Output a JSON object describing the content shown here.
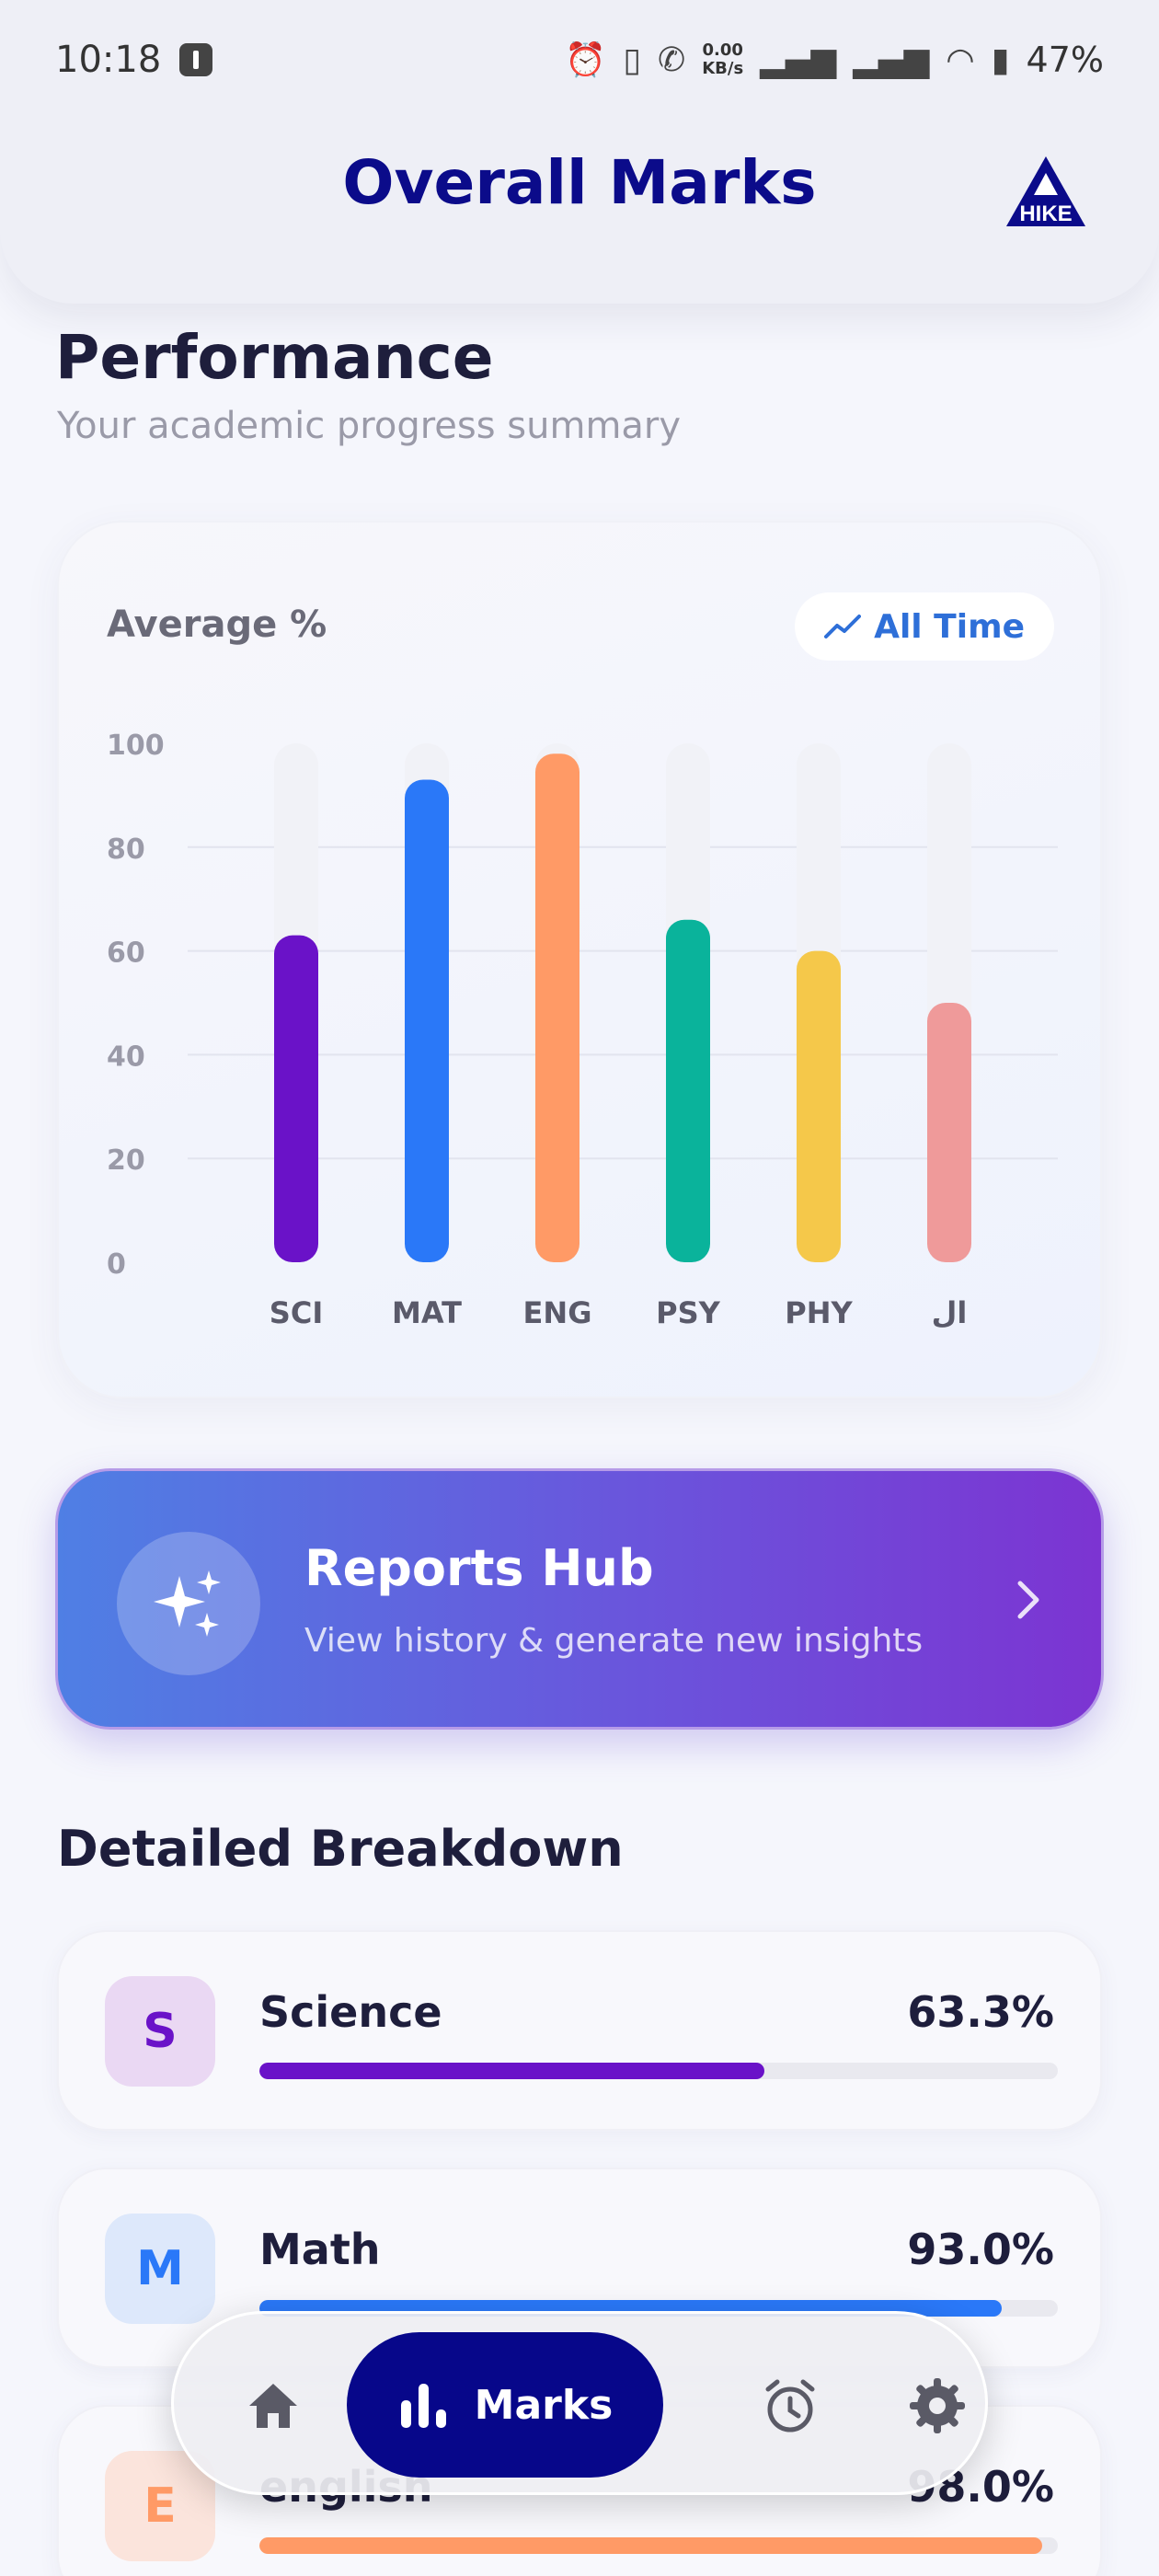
{
  "status_bar": {
    "time": "10:18",
    "speed_top": "0.00",
    "speed_bottom": "KB/s",
    "battery": "47%"
  },
  "header": {
    "title": "Overall Marks",
    "logo_text": "HIKE"
  },
  "performance": {
    "title": "Performance",
    "subtitle": "Your academic progress summary"
  },
  "chart_card": {
    "label": "Average %",
    "range_label": "All Time"
  },
  "chart_data": {
    "type": "bar",
    "categories": [
      "SCI",
      "MAT",
      "ENG",
      "PSY",
      "PHY",
      "ال"
    ],
    "values": [
      63,
      93,
      98,
      66,
      60,
      50
    ],
    "colors": [
      "#6a12c8",
      "#2a78f8",
      "#ff9a66",
      "#0ab39b",
      "#f5c84a",
      "#ef9a9a"
    ],
    "yticks": [
      0,
      20,
      40,
      60,
      80,
      100
    ],
    "ylim": [
      0,
      100
    ],
    "grid": true
  },
  "reports_hub": {
    "title": "Reports Hub",
    "subtitle": "View history & generate new insights"
  },
  "breakdown": {
    "title": "Detailed Breakdown",
    "subjects": [
      {
        "initial": "S",
        "name": "Science",
        "percent_label": "63.3%",
        "value": 63.3,
        "color": "#6a12c8",
        "badge_bg": "#ead8f3"
      },
      {
        "initial": "M",
        "name": "Math",
        "percent_label": "93.0%",
        "value": 93.0,
        "color": "#2a78f8",
        "badge_bg": "#dde8fb"
      },
      {
        "initial": "E",
        "name": "english",
        "percent_label": "98.0%",
        "value": 98.0,
        "color": "#ff9a66",
        "badge_bg": "#fbe4dc"
      }
    ]
  },
  "bottom_nav": {
    "items": [
      {
        "icon": "home-icon"
      },
      {
        "icon": "bar-chart-icon",
        "label": "Marks",
        "active": true
      },
      {
        "icon": "alarm-clock-icon"
      },
      {
        "icon": "gear-icon"
      }
    ]
  }
}
